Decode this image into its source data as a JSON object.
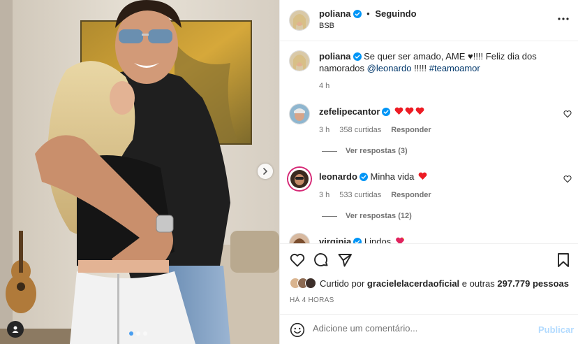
{
  "header": {
    "username": "poliana",
    "separator": "•",
    "follow_status": "Seguindo",
    "location": "BSB"
  },
  "caption": {
    "username": "poliana",
    "text": "Se quer ser amado, AME ♥!!!! Feliz dia dos namorados ",
    "mention": "@leonardo",
    "text2": " !!!!! ",
    "hashtag": "#teamoamor",
    "time": "4 h"
  },
  "comments": [
    {
      "username": "zefelipecantor",
      "text": "",
      "emoji": "hearts-3",
      "time": "3 h",
      "likes": "358 curtidas",
      "reply_label": "Responder",
      "view_replies": "Ver respostas (3)"
    },
    {
      "username": "leonardo",
      "text": "Minha vida",
      "emoji": "heart-1",
      "time": "3 h",
      "likes": "533 curtidas",
      "reply_label": "Responder",
      "view_replies": "Ver respostas (12)"
    },
    {
      "username": "virginia",
      "text": "Lindos",
      "emoji": "heart-sparkle"
    }
  ],
  "likes": {
    "prefix": "Curtido por ",
    "user": "gracielelacerdaoficial",
    "middle": " e outras ",
    "count": "297.779 pessoas"
  },
  "time_ago": "HÁ 4 HORAS",
  "add_comment": {
    "placeholder": "Adicione um comentário...",
    "publish_label": "Publicar"
  },
  "carousel": {
    "slides": 3,
    "active_index": 0
  },
  "colors": {
    "verified": "#0095f6",
    "heart": "#ed1c24",
    "link": "#00376b",
    "publish_disabled": "#b3dbff",
    "secondary_text": "#737373"
  },
  "icons": {
    "like": "heart-outline-icon",
    "comment": "comment-bubble-icon",
    "share": "paper-plane-icon",
    "save": "bookmark-icon",
    "more": "more-options-icon",
    "emoji": "smiley-icon",
    "next": "chevron-right-icon",
    "tag": "user-tag-icon"
  }
}
